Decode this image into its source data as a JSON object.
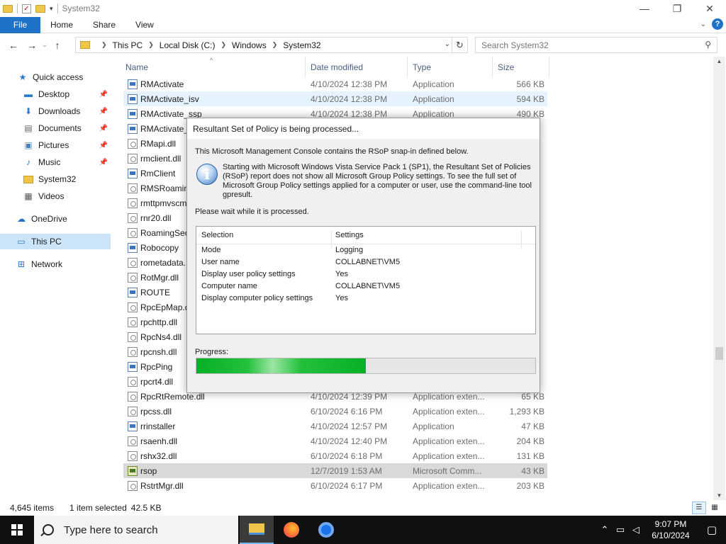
{
  "window": {
    "title": "System32",
    "controls": {
      "minimize": "—",
      "maximize": "❐",
      "close": "✕"
    }
  },
  "ribbon": {
    "file": "File",
    "tabs": [
      "Home",
      "Share",
      "View"
    ],
    "help": "?"
  },
  "address": {
    "crumbs": [
      "This PC",
      "Local Disk (C:)",
      "Windows",
      "System32"
    ],
    "search_placeholder": "Search System32"
  },
  "sidebar": {
    "items": [
      {
        "label": "Quick access",
        "icon": "star-icon"
      },
      {
        "label": "Desktop",
        "icon": "desktop-icon",
        "pinned": true
      },
      {
        "label": "Downloads",
        "icon": "download-icon",
        "pinned": true
      },
      {
        "label": "Documents",
        "icon": "documents-icon",
        "pinned": true
      },
      {
        "label": "Pictures",
        "icon": "pictures-icon",
        "pinned": true
      },
      {
        "label": "Music",
        "icon": "music-icon",
        "pinned": true
      },
      {
        "label": "System32",
        "icon": "folder-icon"
      },
      {
        "label": "Videos",
        "icon": "videos-icon"
      },
      {
        "label": "OneDrive",
        "icon": "cloud-icon"
      },
      {
        "label": "This PC",
        "icon": "computer-icon"
      },
      {
        "label": "Network",
        "icon": "network-icon"
      }
    ]
  },
  "columns": {
    "name": "Name",
    "date": "Date modified",
    "type": "Type",
    "size": "Size"
  },
  "files": [
    {
      "name": "RMActivate",
      "date": "4/10/2024 12:38 PM",
      "type": "Application",
      "size": "566 KB",
      "kind": "exe"
    },
    {
      "name": "RMActivate_isv",
      "date": "4/10/2024 12:38 PM",
      "type": "Application",
      "size": "594 KB",
      "kind": "exe"
    },
    {
      "name": "RMActivate_ssp",
      "date": "4/10/2024 12:38 PM",
      "type": "Application",
      "size": "490 KB",
      "kind": "exe"
    },
    {
      "name": "RMActivate_",
      "date": "",
      "type": "",
      "size": "",
      "kind": "exe"
    },
    {
      "name": "RMapi.dll",
      "date": "",
      "type": "",
      "size": "",
      "kind": "dll"
    },
    {
      "name": "rmclient.dll",
      "date": "",
      "type": "",
      "size": "",
      "kind": "dll"
    },
    {
      "name": "RmClient",
      "date": "",
      "type": "",
      "size": "",
      "kind": "exe"
    },
    {
      "name": "RMSRoamin",
      "date": "",
      "type": "",
      "size": "",
      "kind": "dll"
    },
    {
      "name": "rmttpmvscm",
      "date": "",
      "type": "",
      "size": "",
      "kind": "dll"
    },
    {
      "name": "rnr20.dll",
      "date": "",
      "type": "",
      "size": "",
      "kind": "dll"
    },
    {
      "name": "RoamingSec",
      "date": "",
      "type": "",
      "size": "",
      "kind": "dll"
    },
    {
      "name": "Robocopy",
      "date": "",
      "type": "",
      "size": "",
      "kind": "exe"
    },
    {
      "name": "rometadata.",
      "date": "",
      "type": "",
      "size": "",
      "kind": "dll"
    },
    {
      "name": "RotMgr.dll",
      "date": "",
      "type": "",
      "size": "",
      "kind": "dll"
    },
    {
      "name": "ROUTE",
      "date": "",
      "type": "",
      "size": "",
      "kind": "exe"
    },
    {
      "name": "RpcEpMap.d",
      "date": "",
      "type": "",
      "size": "",
      "kind": "dll"
    },
    {
      "name": "rpchttp.dll",
      "date": "",
      "type": "",
      "size": "",
      "kind": "dll"
    },
    {
      "name": "RpcNs4.dll",
      "date": "",
      "type": "",
      "size": "",
      "kind": "dll"
    },
    {
      "name": "rpcnsh.dll",
      "date": "",
      "type": "",
      "size": "",
      "kind": "dll"
    },
    {
      "name": "RpcPing",
      "date": "",
      "type": "",
      "size": "",
      "kind": "exe"
    },
    {
      "name": "rpcrt4.dll",
      "date": "",
      "type": "",
      "size": "",
      "kind": "dll"
    },
    {
      "name": "RpcRtRemote.dll",
      "date": "4/10/2024 12:39 PM",
      "type": "Application exten...",
      "size": "65 KB",
      "kind": "dll"
    },
    {
      "name": "rpcss.dll",
      "date": "6/10/2024 6:16 PM",
      "type": "Application exten...",
      "size": "1,293 KB",
      "kind": "dll"
    },
    {
      "name": "rrinstaller",
      "date": "4/10/2024 12:57 PM",
      "type": "Application",
      "size": "47 KB",
      "kind": "exe"
    },
    {
      "name": "rsaenh.dll",
      "date": "4/10/2024 12:40 PM",
      "type": "Application exten...",
      "size": "204 KB",
      "kind": "dll"
    },
    {
      "name": "rshx32.dll",
      "date": "6/10/2024 6:18 PM",
      "type": "Application exten...",
      "size": "131 KB",
      "kind": "dll"
    },
    {
      "name": "rsop",
      "date": "12/7/2019 1:53 AM",
      "type": "Microsoft Comm...",
      "size": "43 KB",
      "kind": "msc"
    },
    {
      "name": "RstrtMgr.dll",
      "date": "6/10/2024 6:17 PM",
      "type": "Application exten...",
      "size": "203 KB",
      "kind": "dll"
    }
  ],
  "status": {
    "count": "4,645 items",
    "selected": "1 item selected",
    "selected_size": "42.5 KB"
  },
  "dialog": {
    "title": "Resultant Set of Policy is being processed...",
    "intro": "This Microsoft Management Console contains the RSoP snap-in defined below.",
    "info_line1": "Starting with Microsoft Windows Vista Service Pack 1 (SP1), the Resultant Set of Policies",
    "info_line2": "(RSoP) report does not show all Microsoft Group Policy settings.  To see the full set of",
    "info_line3": "Microsoft Group Policy settings applied for a computer or user, use the command-line tool",
    "info_line4": "gpresult.",
    "wait": "Please wait while it is processed.",
    "col_selection": "Selection",
    "col_settings": "Settings",
    "rows": [
      {
        "k": "Mode",
        "v": "Logging"
      },
      {
        "k": "User name",
        "v": "COLLABNET\\VM5"
      },
      {
        "k": "Display user policy settings",
        "v": "Yes"
      },
      {
        "k": "Computer name",
        "v": "COLLABNET\\VM5"
      },
      {
        "k": "Display computer policy settings",
        "v": "Yes"
      }
    ],
    "progress_label": "Progress:",
    "progress": 0.5
  },
  "taskbar": {
    "search_placeholder": "Type here to search",
    "time": "9:07 PM",
    "date": "6/10/2024"
  }
}
